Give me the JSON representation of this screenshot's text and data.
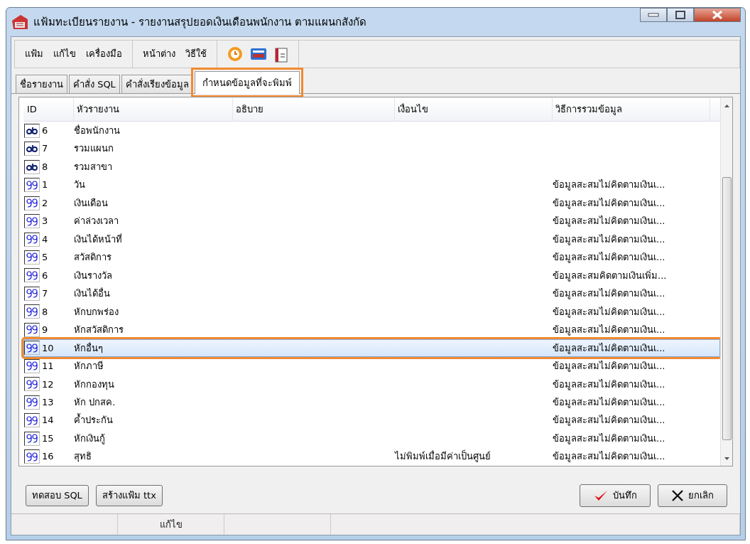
{
  "window": {
    "title": "แฟ้มทะเบียนรายงาน - รายงานสรุปยอดเงินเดือนพนักงาน ตามแผนกสังกัด"
  },
  "menu": {
    "groups": [
      [
        "แฟ้ม",
        "แก้ไข",
        "เครื่องมือ"
      ],
      [
        "หน้าต่าง",
        "วิธีใช้"
      ]
    ]
  },
  "tabs": [
    {
      "label": "ชื่อรายงาน",
      "selected": false,
      "highlighted": false
    },
    {
      "label": "คำสั่ง SQL",
      "selected": false,
      "highlighted": false
    },
    {
      "label": "คำสั่งเรียงข้อมูล",
      "selected": false,
      "highlighted": false
    },
    {
      "label": "กำหนดข้อมูลที่จะพิมพ์",
      "selected": true,
      "highlighted": true
    }
  ],
  "table": {
    "columns": [
      "ID",
      "หัวรายงาน",
      "อธิบาย",
      "เงื่อนไข",
      "วิธีการรวมข้อมูล"
    ],
    "rows": [
      {
        "kind": "text",
        "id": "6",
        "title": "ชื่อพนักงาน",
        "selected": false,
        "highlighted": false
      },
      {
        "kind": "text",
        "id": "7",
        "title": "รวมแผนก",
        "selected": false,
        "highlighted": false
      },
      {
        "kind": "text",
        "id": "8",
        "title": "รวมสาขา",
        "selected": false,
        "highlighted": false
      },
      {
        "kind": "number",
        "id": "1",
        "title": "วัน",
        "method": "ข้อมูลสะสมไม่คิดตามเงินเ...",
        "selected": false,
        "highlighted": false
      },
      {
        "kind": "number",
        "id": "2",
        "title": "เงินเดือน",
        "method": "ข้อมูลสะสมไม่คิดตามเงินเ...",
        "selected": false,
        "highlighted": false
      },
      {
        "kind": "number",
        "id": "3",
        "title": "ค่าล่วงเวลา",
        "method": "ข้อมูลสะสมไม่คิดตามเงินเ...",
        "selected": false,
        "highlighted": false
      },
      {
        "kind": "number",
        "id": "4",
        "title": "เงินได้หน้าที่",
        "method": "ข้อมูลสะสมไม่คิดตามเงินเ...",
        "selected": false,
        "highlighted": false
      },
      {
        "kind": "number",
        "id": "5",
        "title": "สวัสดิการ",
        "method": "ข้อมูลสะสมไม่คิดตามเงินเ...",
        "selected": false,
        "highlighted": false
      },
      {
        "kind": "number",
        "id": "6",
        "title": "เงินรางวัล",
        "method": "ข้อมูลสะสมคิดตามเงินเพิ่ม...",
        "selected": false,
        "highlighted": false
      },
      {
        "kind": "number",
        "id": "7",
        "title": "เงินได้อื่น",
        "method": "ข้อมูลสะสมไม่คิดตามเงินเ...",
        "selected": false,
        "highlighted": false
      },
      {
        "kind": "number",
        "id": "8",
        "title": "หักบกพร่อง",
        "method": "ข้อมูลสะสมไม่คิดตามเงินเ...",
        "selected": false,
        "highlighted": false
      },
      {
        "kind": "number",
        "id": "9",
        "title": "หักสวัสดิการ",
        "method": "ข้อมูลสะสมไม่คิดตามเงินเ...",
        "selected": false,
        "highlighted": false
      },
      {
        "kind": "number",
        "id": "10",
        "title": "หักอื่นๆ",
        "method": "ข้อมูลสะสมไม่คิดตามเงินเ...",
        "selected": true,
        "highlighted": true
      },
      {
        "kind": "number",
        "id": "11",
        "title": "หักภาษี",
        "method": "ข้อมูลสะสมไม่คิดตามเงินเ...",
        "selected": false,
        "highlighted": false
      },
      {
        "kind": "number",
        "id": "12",
        "title": "หักกองทุน",
        "method": "ข้อมูลสะสมไม่คิดตามเงินเ...",
        "selected": false,
        "highlighted": false
      },
      {
        "kind": "number",
        "id": "13",
        "title": "หัก ปกสค.",
        "method": "ข้อมูลสะสมไม่คิดตามเงินเ...",
        "selected": false,
        "highlighted": false
      },
      {
        "kind": "number",
        "id": "14",
        "title": "ค้ำประกัน",
        "method": "ข้อมูลสะสมไม่คิดตามเงินเ...",
        "selected": false,
        "highlighted": false
      },
      {
        "kind": "number",
        "id": "15",
        "title": "หักเงินกู้",
        "method": "ข้อมูลสะสมไม่คิดตามเงินเ...",
        "selected": false,
        "highlighted": false
      },
      {
        "kind": "number",
        "id": "16",
        "title": "สุทธิ",
        "condition": "ไม่พิมพ์เมื่อมีค่าเป็นศูนย์",
        "method": "ข้อมูลสะสมไม่คิดตามเงินเ...",
        "selected": false,
        "highlighted": false
      }
    ]
  },
  "left_buttons": [
    "ทดสอบ SQL",
    "สร้างแฟ้ม ttx"
  ],
  "save_button": "บันทึก",
  "cancel_button": "ยกเลิก",
  "status_bar": {
    "field_2": "แก้ไข"
  }
}
